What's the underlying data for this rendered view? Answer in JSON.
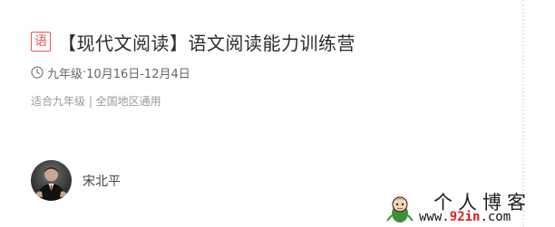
{
  "course": {
    "subject_badge": "语",
    "title": "【现代文阅读】语文阅读能力训练营",
    "grade": "九年级",
    "separator": " · ",
    "date_range": "10月16日-12月4日",
    "scope": "适合九年级 | 全国地区通用"
  },
  "teacher": {
    "name": "宋北平"
  },
  "watermark": {
    "title": "个人博客",
    "url_prefix": "www.",
    "url_highlight": "92in",
    "url_suffix": ".com"
  },
  "colors": {
    "badge": "#e8584f",
    "title": "#2b2b2b",
    "meta": "#666666",
    "scope": "#999999",
    "watermark_highlight": "#e11e1e"
  }
}
